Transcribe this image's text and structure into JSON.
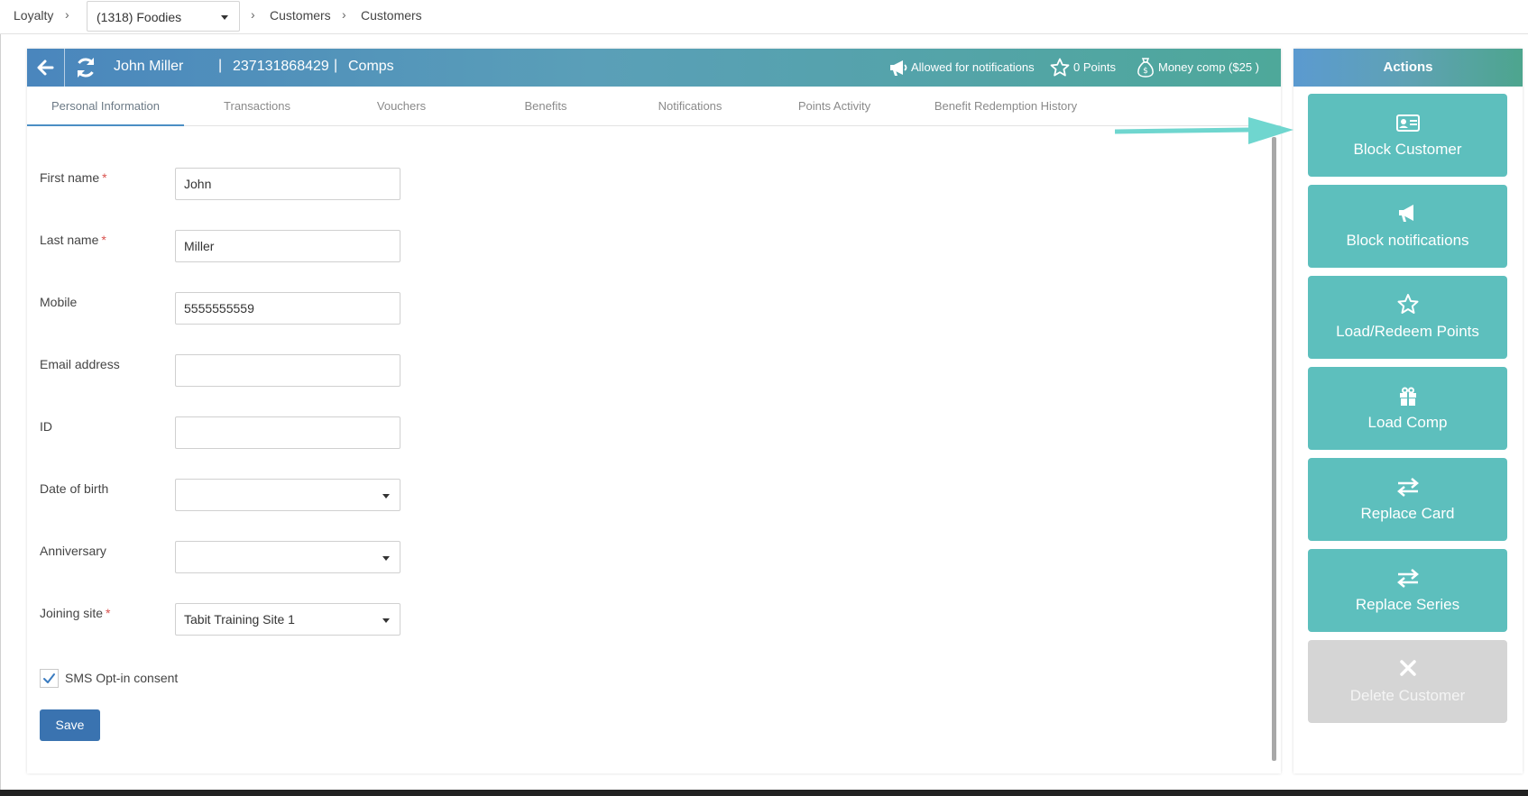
{
  "breadcrumb": {
    "root": "Loyalty",
    "site_select": "(1318) Foodies",
    "crumb_1": "Customers",
    "crumb_2": "Customers",
    "separator": "›"
  },
  "customer_header": {
    "name": "John Miller",
    "card_number": "237131868429",
    "section": "Comps",
    "divider": "|",
    "notifications_status": "Allowed for notifications",
    "points": "0 Points",
    "money_comp": "Money comp ($25 )"
  },
  "tabs": [
    {
      "label": "Personal Information",
      "active": true
    },
    {
      "label": "Transactions",
      "active": false
    },
    {
      "label": "Vouchers",
      "active": false
    },
    {
      "label": "Benefits",
      "active": false
    },
    {
      "label": "Notifications",
      "active": false
    },
    {
      "label": "Points Activity",
      "active": false
    },
    {
      "label": "Benefit Redemption History",
      "active": false
    }
  ],
  "form": {
    "first_name": {
      "label": "First name",
      "value": "John",
      "required_mark": "*"
    },
    "last_name": {
      "label": "Last name",
      "value": "Miller",
      "required_mark": "*"
    },
    "mobile": {
      "label": "Mobile",
      "value": "5555555559"
    },
    "email": {
      "label": "Email address",
      "value": ""
    },
    "id": {
      "label": "ID",
      "value": ""
    },
    "date_of_birth": {
      "label": "Date of birth",
      "value": ""
    },
    "anniversary": {
      "label": "Anniversary",
      "value": ""
    },
    "joining_site": {
      "label": "Joining site",
      "value": "Tabit Training Site 1",
      "required_mark": "*"
    },
    "sms_consent": {
      "label": "SMS Opt-in consent",
      "checked": true
    },
    "save_label": "Save"
  },
  "actions": {
    "title": "Actions",
    "items": [
      {
        "label": "Block Customer",
        "icon": "id-card-icon",
        "enabled": true
      },
      {
        "label": "Block notifications",
        "icon": "megaphone-icon",
        "enabled": true
      },
      {
        "label": "Load/Redeem Points",
        "icon": "star-icon",
        "enabled": true
      },
      {
        "label": "Load Comp",
        "icon": "gift-icon",
        "enabled": true
      },
      {
        "label": "Replace Card",
        "icon": "swap-arrows-icon",
        "enabled": true
      },
      {
        "label": "Replace Series",
        "icon": "swap-arrows-icon",
        "enabled": true
      },
      {
        "label": "Delete Customer",
        "icon": "x-icon",
        "enabled": false
      }
    ]
  },
  "colors": {
    "action_button": "#5dbfbd",
    "action_disabled": "#d5d5d5",
    "save_button": "#3a73b0",
    "active_tab_underline": "#4b8ec4",
    "annotation_arrow": "#6fd6cf"
  }
}
